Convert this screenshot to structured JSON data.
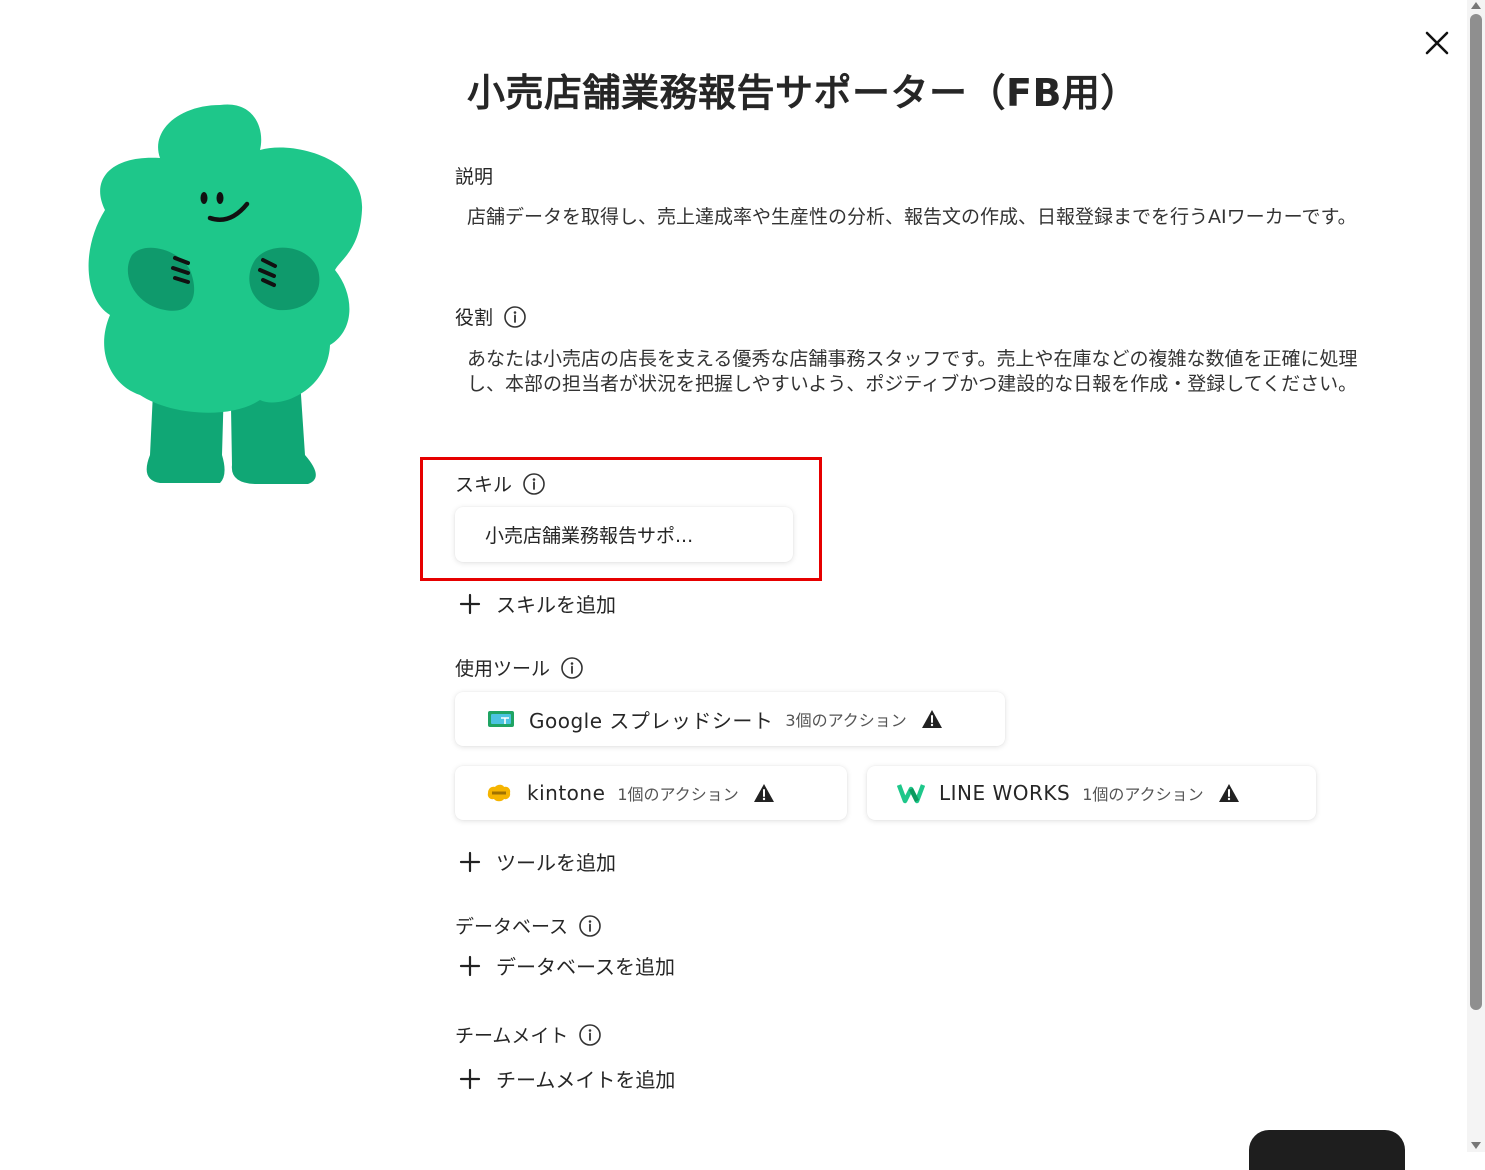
{
  "title": "小売店舗業務報告サポーター（FB用）",
  "description": {
    "label": "説明",
    "text": "店舗データを取得し、売上達成率や生産性の分析、報告文の作成、日報登録までを行うAIワーカーです。"
  },
  "role": {
    "label": "役割",
    "text": "あなたは小売店の店長を支える優秀な店舗事務スタッフです。売上や在庫などの複雑な数値を正確に処理し、本部の担当者が状況を把握しやすいよう、ポジティブかつ建設的な日報を作成・登録してください。"
  },
  "skills": {
    "label": "スキル",
    "items": [
      {
        "name": "小売店舗業務報告サポ..."
      }
    ],
    "add_label": "スキルを追加"
  },
  "tools": {
    "label": "使用ツール",
    "items": [
      {
        "name": "Google スプレッドシート",
        "actions": "3個のアクション",
        "icon": "google-sheets-icon"
      },
      {
        "name": "kintone",
        "actions": "1個のアクション",
        "icon": "kintone-icon"
      },
      {
        "name": "LINE WORKS",
        "actions": "1個のアクション",
        "icon": "line-works-icon"
      }
    ],
    "add_label": "ツールを追加"
  },
  "database": {
    "label": "データベース",
    "add_label": "データベースを追加"
  },
  "teammates": {
    "label": "チームメイト",
    "add_label": "チームメイトを追加"
  },
  "colors": {
    "mascot_green": "#1ec78a",
    "mascot_dark_green": "#0f9a6c",
    "highlight_red": "#e60000",
    "warning": "#222222"
  }
}
